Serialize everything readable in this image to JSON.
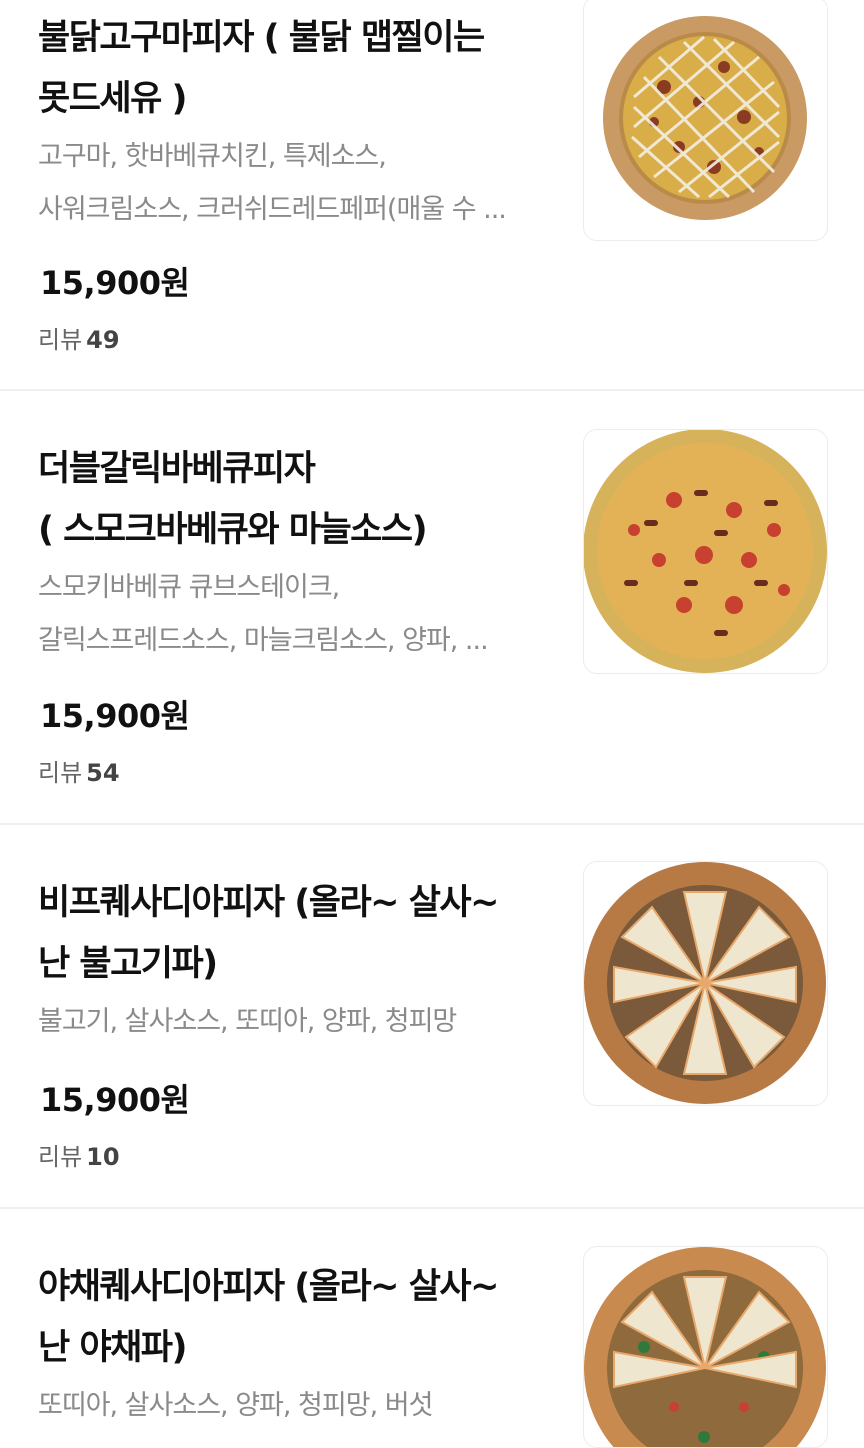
{
  "menu": {
    "items": [
      {
        "name_lines": [
          "불닭고구마피자 ( 불닭 맵찔이는",
          "못드세유 )"
        ],
        "desc_lines": [
          "고구마, 핫바베큐치킨, 특제소스,",
          "사워크림소스, 크러쉬드레드페퍼(매울 수 ..."
        ],
        "price": "15,900원",
        "review_label": "리뷰",
        "review_count": "49",
        "image": "pizza-sweetpotato-icon"
      },
      {
        "name_lines": [
          "더블갈릭바베큐피자",
          "( 스모크바베큐와 마늘소스)"
        ],
        "desc_lines": [
          "스모키바베큐 큐브스테이크,",
          "갈릭스프레드소스, 마늘크림소스, 양파, ..."
        ],
        "price": "15,900원",
        "review_label": "리뷰",
        "review_count": "54",
        "image": "pizza-garlic-bbq-icon"
      },
      {
        "name_lines": [
          "비프퀘사디아피자 (올라~ 살사~",
          "난 불고기파)"
        ],
        "desc_lines": [
          "불고기, 살사소스, 또띠아, 양파, 청피망"
        ],
        "price": "15,900원",
        "review_label": "리뷰",
        "review_count": "10",
        "image": "pizza-beef-quesadilla-icon"
      },
      {
        "name_lines": [
          "야채퀘사디아피자 (올라~ 살사~",
          "난 야채파)"
        ],
        "desc_lines": [
          "또띠아, 살사소스, 양파, 청피망, 버섯"
        ],
        "image": "pizza-veggie-quesadilla-icon"
      }
    ]
  }
}
